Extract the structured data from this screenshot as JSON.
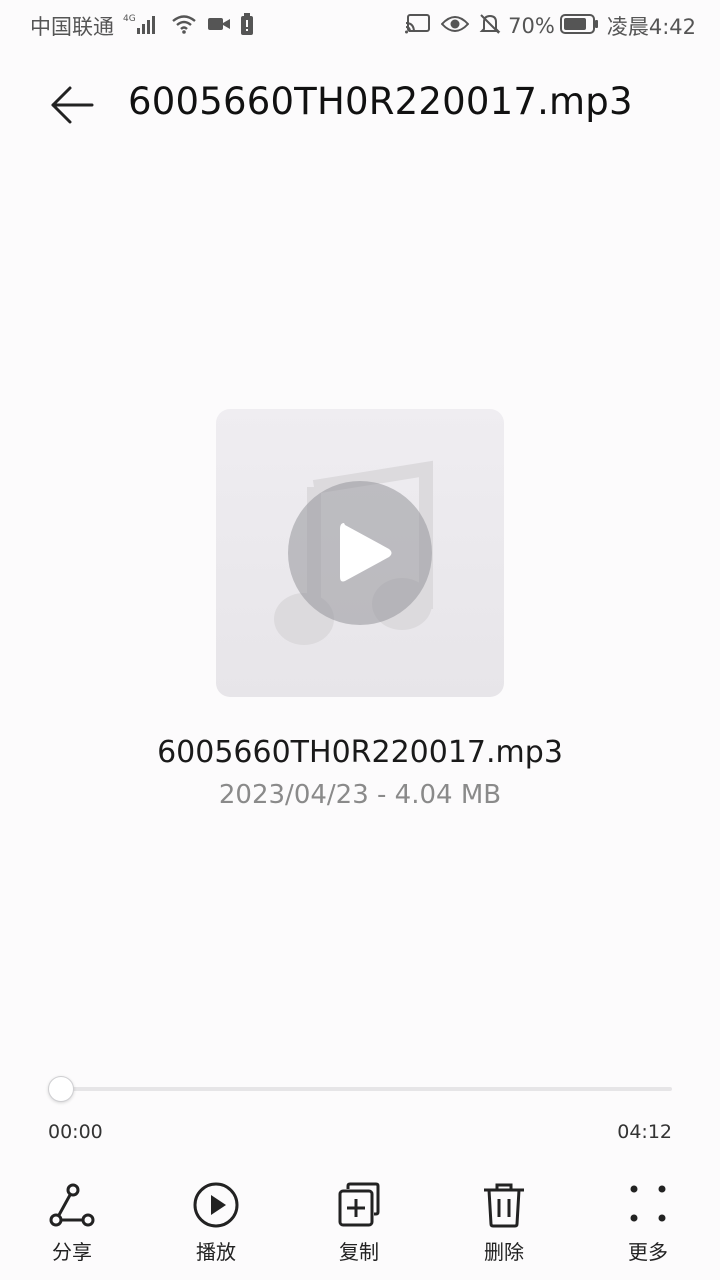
{
  "status_bar": {
    "carrier": "中国联通",
    "network": "4G",
    "battery": "70%",
    "time": "凌晨4:42"
  },
  "header": {
    "title": "6005660TH0R220017.mp3",
    "back_icon": "back-arrow-icon"
  },
  "file": {
    "name": "6005660TH0R220017.mp3",
    "meta": "2023/04/23 - 4.04 MB"
  },
  "player": {
    "current_time": "00:00",
    "total_time": "04:12",
    "progress": 0
  },
  "toolbar": {
    "items": [
      {
        "label": "分享",
        "icon": "share-icon"
      },
      {
        "label": "播放",
        "icon": "play-circle-icon"
      },
      {
        "label": "复制",
        "icon": "copy-icon"
      },
      {
        "label": "删除",
        "icon": "trash-icon"
      },
      {
        "label": "更多",
        "icon": "more-icon"
      }
    ]
  },
  "colors": {
    "background": "#fcfbfc",
    "text": "#1a1a1a",
    "secondary_text": "#8a8a8a",
    "track": "#e6e5e7"
  }
}
